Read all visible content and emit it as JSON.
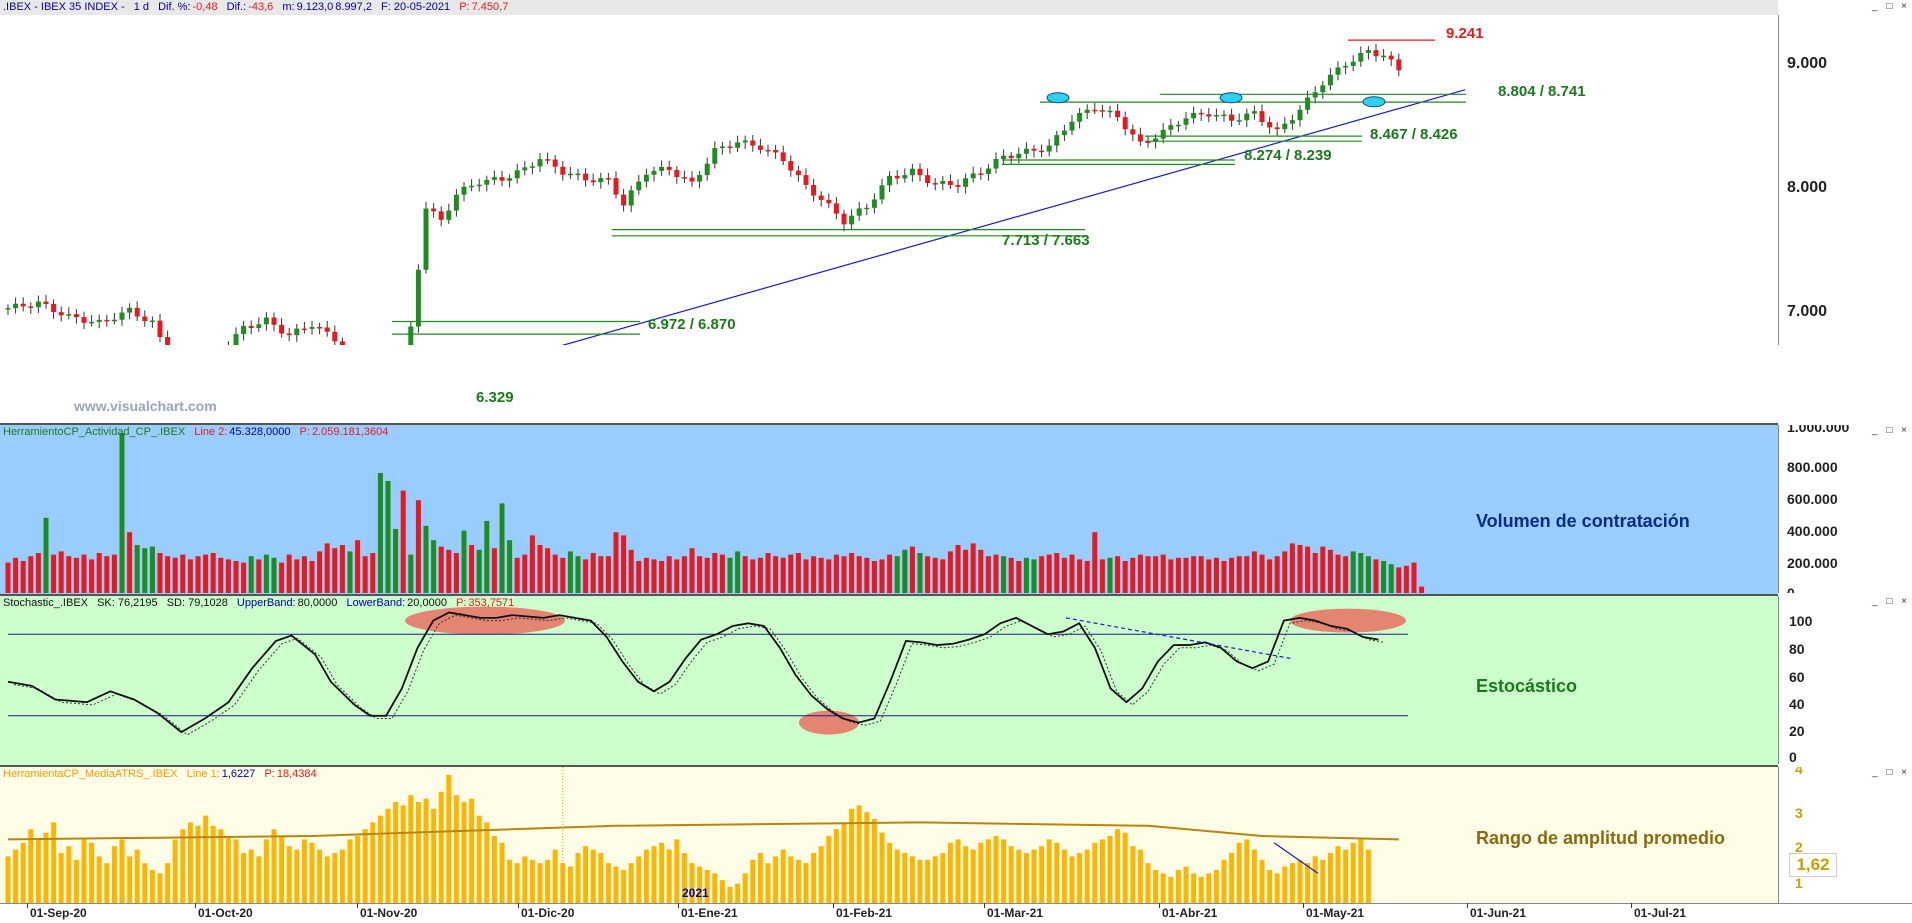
{
  "price_header": {
    "symbol": ".IBEX - IBEX 35 INDEX -",
    "period": "1 d",
    "dif_pct_label": "Dif. %:",
    "dif_pct": "-0,48",
    "dif_label": "Dif.:",
    "dif": "-43,6",
    "m_label": "m:",
    "m": "9.123,0",
    "m2": "8.997,2",
    "date": "F: 20-05-2021",
    "p_label": "P:",
    "p": "7.450,7"
  },
  "volume_header": {
    "name": "HerramientoCP_Actividad_CP_.IBEX",
    "line_label": "Line 2:",
    "line_value": "45.328,0000",
    "p_label": "P:",
    "p_value": "2.059.181,3604"
  },
  "stoch_header": {
    "name": "Stochastic_.IBEX",
    "sk": "SK: 76,2195",
    "sd": "SD: 79,1028",
    "ub_label": "UpperBand:",
    "ub": "80,0000",
    "lb_label": "LowerBand:",
    "lb": "20,0000",
    "p_label": "P:",
    "p": "353,7571"
  },
  "atr_header": {
    "name": "HerramientaCP_MediaATRS_.IBEX",
    "line_label": "Line 1:",
    "line_value": "1,6227",
    "p_label": "P:",
    "p_value": "18,4384"
  },
  "window_buttons": "_ □ ×",
  "watermark": "www.visualchart.com",
  "panel_labels": {
    "volume": "Volumen de contratación",
    "stoch": "Estocástico",
    "atr": "Rango de amplitud promedio"
  },
  "atr_value_box": "1,62",
  "year_label": "2021",
  "colors": {
    "up": "#1e8c1e",
    "down": "#e8191e",
    "trend": "#1a1acc",
    "volume_bg": "#99ccff",
    "stoch_bg": "#ccffcc",
    "atr_bg": "#fffde8",
    "atr_bar": "#ffb400",
    "atr_avg": "#b8860b",
    "highlight": "#e87060",
    "marker": "#30d0f0"
  },
  "chart_data": [
    {
      "type": "candlestick",
      "title": "IBEX 35 INDEX",
      "x_dates": [
        "01-Sep-20",
        "01-Oct-20",
        "01-Nov-20",
        "01-Dic-20",
        "01-Ene-21",
        "01-Feb-21",
        "01-Mar-21",
        "01-Abr-21",
        "01-May-21",
        "01-Jun-21",
        "01-Jul-21"
      ],
      "y_ticks": [
        "9.000",
        "8.000",
        "7.000"
      ],
      "ylim": [
        6200,
        9400
      ],
      "close_path": [
        [
          0,
          7080
        ],
        [
          4,
          7120
        ],
        [
          8,
          7010
        ],
        [
          12,
          6960
        ],
        [
          16,
          7060
        ],
        [
          19,
          6960
        ],
        [
          22,
          6580
        ],
        [
          25,
          6630
        ],
        [
          28,
          6720
        ],
        [
          31,
          6920
        ],
        [
          34,
          6980
        ],
        [
          37,
          6860
        ],
        [
          40,
          6950
        ],
        [
          43,
          6830
        ],
        [
          46,
          6450
        ],
        [
          48,
          6360
        ],
        [
          51,
          6420
        ],
        [
          53,
          6910
        ],
        [
          55,
          7900
        ],
        [
          57,
          7780
        ],
        [
          59,
          8000
        ],
        [
          62,
          8100
        ],
        [
          65,
          8120
        ],
        [
          68,
          8200
        ],
        [
          70,
          8290
        ],
        [
          73,
          8180
        ],
        [
          76,
          8120
        ],
        [
          79,
          8110
        ],
        [
          81,
          7920
        ],
        [
          84,
          8180
        ],
        [
          87,
          8200
        ],
        [
          90,
          8080
        ],
        [
          93,
          8350
        ],
        [
          96,
          8420
        ],
        [
          99,
          8380
        ],
        [
          102,
          8280
        ],
        [
          105,
          8060
        ],
        [
          107,
          7960
        ],
        [
          110,
          7780
        ],
        [
          113,
          7900
        ],
        [
          116,
          8130
        ],
        [
          119,
          8180
        ],
        [
          122,
          8080
        ],
        [
          125,
          8080
        ],
        [
          128,
          8180
        ],
        [
          131,
          8300
        ],
        [
          134,
          8340
        ],
        [
          137,
          8380
        ],
        [
          140,
          8600
        ],
        [
          143,
          8700
        ],
        [
          146,
          8620
        ],
        [
          149,
          8400
        ],
        [
          152,
          8500
        ],
        [
          155,
          8620
        ],
        [
          158,
          8650
        ],
        [
          161,
          8600
        ],
        [
          164,
          8650
        ],
        [
          167,
          8500
        ],
        [
          170,
          8680
        ],
        [
          173,
          8900
        ],
        [
          176,
          9050
        ],
        [
          179,
          9150
        ],
        [
          181,
          9120
        ],
        [
          183,
          9000
        ]
      ],
      "levels": [
        {
          "label": "9.241",
          "value": 9241,
          "color": "#e8191e"
        },
        {
          "label": "8.804 / 8.741",
          "values": [
            8804,
            8741
          ]
        },
        {
          "label": "8.467 / 8.426",
          "values": [
            8467,
            8426
          ]
        },
        {
          "label": "8.274 / 8.239",
          "values": [
            8274,
            8239
          ]
        },
        {
          "label": "7.713 / 7.663",
          "values": [
            7713,
            7663
          ]
        },
        {
          "label": "6.972 / 6.870",
          "values": [
            6972,
            6870
          ]
        },
        {
          "label": "6.329",
          "value": 6329
        }
      ]
    },
    {
      "type": "bar",
      "title": "Volumen de contratación",
      "y_ticks": [
        "1.000.000",
        "800.000",
        "600.000",
        "400.000",
        "200.000",
        "0"
      ],
      "ylim": [
        0,
        1000000
      ],
      "values_k": [
        190,
        220,
        200,
        230,
        250,
        470,
        240,
        260,
        230,
        220,
        240,
        210,
        250,
        230,
        240,
        1000,
        380,
        300,
        280,
        290,
        250,
        230,
        220,
        240,
        210,
        230,
        240,
        250,
        220,
        210,
        200,
        190,
        230,
        210,
        240,
        220,
        190,
        240,
        210,
        230,
        200,
        260,
        310,
        280,
        300,
        260,
        330,
        230,
        250,
        750,
        700,
        400,
        640,
        240,
        580,
        420,
        330,
        290,
        270,
        250,
        390,
        300,
        270,
        450,
        280,
        560,
        330,
        220,
        240,
        360,
        300,
        280,
        240,
        220,
        260,
        230,
        210,
        250,
        230,
        230,
        380,
        360,
        270,
        200,
        220,
        210,
        200,
        230,
        210,
        230,
        280,
        230,
        220,
        250,
        240,
        220,
        260,
        230,
        210,
        220,
        250,
        230,
        220,
        240,
        250,
        210,
        230,
        220,
        210,
        240,
        230,
        250,
        230,
        220,
        200,
        210,
        240,
        230,
        270,
        290,
        250,
        230,
        220,
        210,
        260,
        300,
        270,
        310,
        270,
        230,
        240,
        230,
        220,
        200,
        220,
        210,
        230,
        240,
        250,
        220,
        240,
        210,
        200,
        380,
        210,
        220,
        230,
        200,
        220,
        240,
        230,
        230,
        240,
        210,
        220,
        220,
        230,
        230,
        210,
        220,
        200,
        220,
        230,
        230,
        260,
        240,
        210,
        230,
        260,
        310,
        300,
        290,
        250,
        290,
        270,
        240,
        230,
        260,
        250,
        230,
        210,
        200,
        180,
        160,
        170,
        190,
        40
      ],
      "colors_up_idx": [
        5,
        15,
        17,
        18,
        19,
        32,
        34,
        35,
        45,
        49,
        50,
        51,
        53,
        55,
        56,
        60,
        62,
        63,
        65,
        66,
        74,
        75,
        95,
        96,
        117,
        118,
        120,
        131,
        134,
        135,
        145,
        177,
        178,
        179,
        181,
        182
      ]
    },
    {
      "type": "line",
      "title": "Estocástico",
      "y_ticks": [
        "100",
        "80",
        "60",
        "40",
        "20",
        "0"
      ],
      "ylim": [
        0,
        100
      ],
      "bands": [
        80,
        20
      ],
      "sk": [
        [
          0,
          45
        ],
        [
          3,
          42
        ],
        [
          6,
          32
        ],
        [
          10,
          30
        ],
        [
          13,
          38
        ],
        [
          16,
          32
        ],
        [
          19,
          22
        ],
        [
          22,
          8
        ],
        [
          25,
          18
        ],
        [
          28,
          30
        ],
        [
          31,
          55
        ],
        [
          34,
          75
        ],
        [
          36,
          79
        ],
        [
          39,
          65
        ],
        [
          41,
          45
        ],
        [
          44,
          28
        ],
        [
          46,
          20
        ],
        [
          48,
          20
        ],
        [
          50,
          40
        ],
        [
          52,
          70
        ],
        [
          54,
          90
        ],
        [
          56,
          96
        ],
        [
          58,
          94
        ],
        [
          60,
          92
        ],
        [
          62,
          92
        ],
        [
          64,
          94
        ],
        [
          66,
          93
        ],
        [
          68,
          92
        ],
        [
          70,
          94
        ],
        [
          72,
          92
        ],
        [
          74,
          90
        ],
        [
          76,
          78
        ],
        [
          78,
          60
        ],
        [
          80,
          45
        ],
        [
          82,
          38
        ],
        [
          84,
          45
        ],
        [
          86,
          62
        ],
        [
          88,
          76
        ],
        [
          90,
          80
        ],
        [
          92,
          86
        ],
        [
          94,
          88
        ],
        [
          96,
          86
        ],
        [
          98,
          70
        ],
        [
          100,
          50
        ],
        [
          102,
          35
        ],
        [
          104,
          25
        ],
        [
          106,
          18
        ],
        [
          108,
          15
        ],
        [
          110,
          18
        ],
        [
          112,
          45
        ],
        [
          114,
          75
        ],
        [
          116,
          74
        ],
        [
          118,
          72
        ],
        [
          120,
          73
        ],
        [
          122,
          76
        ],
        [
          124,
          80
        ],
        [
          126,
          88
        ],
        [
          128,
          92
        ],
        [
          130,
          86
        ],
        [
          132,
          80
        ],
        [
          134,
          82
        ],
        [
          136,
          88
        ],
        [
          138,
          70
        ],
        [
          140,
          40
        ],
        [
          142,
          30
        ],
        [
          144,
          40
        ],
        [
          146,
          60
        ],
        [
          148,
          72
        ],
        [
          150,
          72
        ],
        [
          152,
          74
        ],
        [
          154,
          70
        ],
        [
          156,
          60
        ],
        [
          158,
          55
        ],
        [
          160,
          60
        ],
        [
          162,
          90
        ],
        [
          164,
          92
        ],
        [
          166,
          90
        ],
        [
          168,
          86
        ],
        [
          170,
          84
        ],
        [
          172,
          78
        ],
        [
          174,
          76
        ]
      ],
      "highlights": [
        "overbought Nov-Dic 20",
        "oversold Feb-21",
        "overbought May-21"
      ]
    },
    {
      "type": "bar",
      "title": "Rango de amplitud promedio",
      "y_ticks": [
        "4",
        "3",
        "2",
        "1"
      ],
      "ylim": [
        0,
        4
      ],
      "values": [
        1.4,
        1.6,
        1.8,
        2.2,
        1.9,
        2.1,
        2.4,
        1.5,
        1.7,
        1.3,
        1.9,
        1.8,
        1.4,
        1.2,
        1.7,
        1.9,
        1.4,
        1.6,
        1.2,
        1.0,
        0.9,
        1.2,
        1.9,
        2.2,
        2.4,
        2.3,
        2.6,
        2.3,
        2.2,
        2.0,
        1.9,
        1.5,
        1.6,
        1.4,
        1.9,
        2.2,
        2.0,
        1.7,
        1.6,
        1.9,
        1.8,
        1.6,
        1.4,
        1.5,
        1.6,
        1.9,
        2.0,
        2.2,
        2.4,
        2.6,
        2.8,
        3.0,
        2.9,
        3.2,
        3.0,
        3.1,
        2.8,
        3.3,
        3.8,
        3.2,
        3.0,
        3.1,
        2.6,
        2.4,
        2.0,
        1.8,
        1.3,
        1.2,
        1.4,
        1.3,
        1.2,
        1.3,
        1.6,
        1.2,
        1.1,
        1.5,
        1.7,
        1.6,
        1.5,
        1.2,
        1.1,
        1.0,
        1.2,
        1.4,
        1.6,
        1.7,
        1.8,
        1.6,
        1.9,
        1.5,
        1.2,
        1.1,
        1.0,
        0.9,
        0.7,
        0.5,
        0.6,
        0.9,
        1.3,
        1.5,
        1.2,
        1.4,
        1.6,
        1.4,
        1.3,
        1.2,
        1.5,
        1.7,
        2.0,
        2.2,
        2.4,
        2.8,
        2.9,
        2.7,
        2.5,
        2.1,
        1.8,
        1.6,
        1.5,
        1.4,
        1.3,
        1.3,
        1.4,
        1.5,
        1.8,
        1.9,
        1.7,
        1.6,
        1.8,
        1.9,
        2.0,
        1.9,
        1.7,
        1.6,
        1.5,
        1.6,
        1.7,
        1.9,
        1.8,
        1.6,
        1.4,
        1.5,
        1.6,
        1.8,
        1.9,
        2.0,
        2.2,
        2.1,
        1.7,
        1.6,
        1.2,
        1.0,
        0.9,
        0.8,
        1.0,
        1.1,
        0.9,
        0.8,
        0.9,
        1.0,
        1.3,
        1.5,
        1.8,
        1.9,
        1.6,
        1.3,
        1.0,
        0.9,
        1.1,
        1.2,
        1.3,
        1.2,
        1.4,
        1.3,
        1.5,
        1.7,
        1.6,
        1.8,
        1.9,
        1.6
      ],
      "average_line": [
        [
          0,
          1.9
        ],
        [
          40,
          2.0
        ],
        [
          80,
          2.3
        ],
        [
          120,
          2.4
        ],
        [
          150,
          2.3
        ],
        [
          165,
          2.0
        ],
        [
          183,
          1.9
        ]
      ]
    }
  ]
}
